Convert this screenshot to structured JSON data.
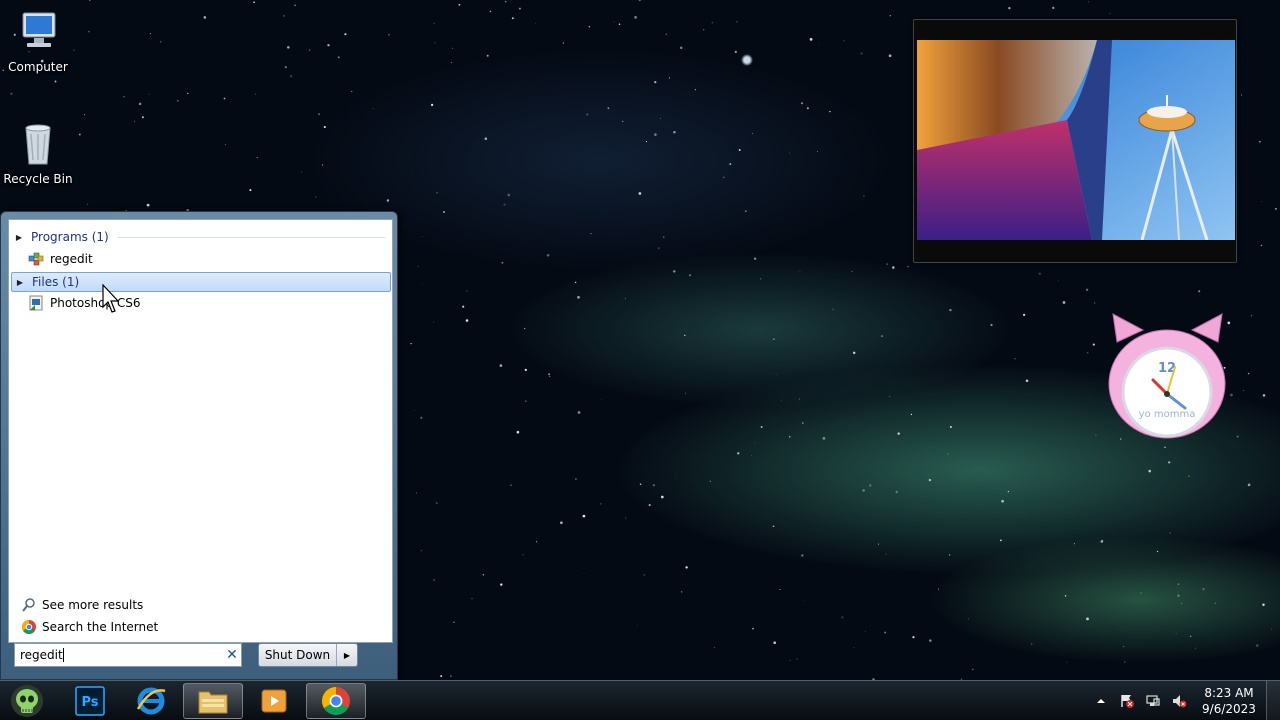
{
  "desktop": {
    "icons": [
      {
        "label": "Computer",
        "icon": "computer-icon"
      },
      {
        "label": "Recycle Bin",
        "icon": "recycle-bin-icon"
      }
    ]
  },
  "gadgets": {
    "photo": {
      "icon": "slideshow-photo"
    },
    "clock": {
      "face_text": "yo momma",
      "twelve": "12"
    }
  },
  "start_menu": {
    "groups": [
      {
        "label": "Programs (1)",
        "items": [
          {
            "label": "regedit",
            "icon": "regedit-icon"
          }
        ]
      },
      {
        "label": "Files (1)",
        "items": [
          {
            "label": "Photoshop CS6",
            "icon": "file-shortcut-icon"
          }
        ],
        "selected": true
      }
    ],
    "see_more": "See more results",
    "search_internet": "Search the Internet",
    "search": {
      "value": "regedit"
    },
    "shutdown_label": "Shut Down"
  },
  "taskbar": {
    "buttons": [
      {
        "name": "start-orb",
        "icon": "skull-orb-icon"
      },
      {
        "name": "photoshop",
        "icon": "photoshop-icon",
        "text": "Ps"
      },
      {
        "name": "internet-explorer",
        "icon": "ie-icon"
      },
      {
        "name": "windows-explorer",
        "icon": "folder-icon"
      },
      {
        "name": "media-player",
        "icon": "media-player-icon"
      },
      {
        "name": "chrome",
        "icon": "chrome-icon"
      }
    ],
    "time": "8:23 AM",
    "date": "9/6/2023"
  },
  "colors": {
    "accent": "#1e3287",
    "selection": "#c1dbfc",
    "taskbar": "#0b1118"
  }
}
